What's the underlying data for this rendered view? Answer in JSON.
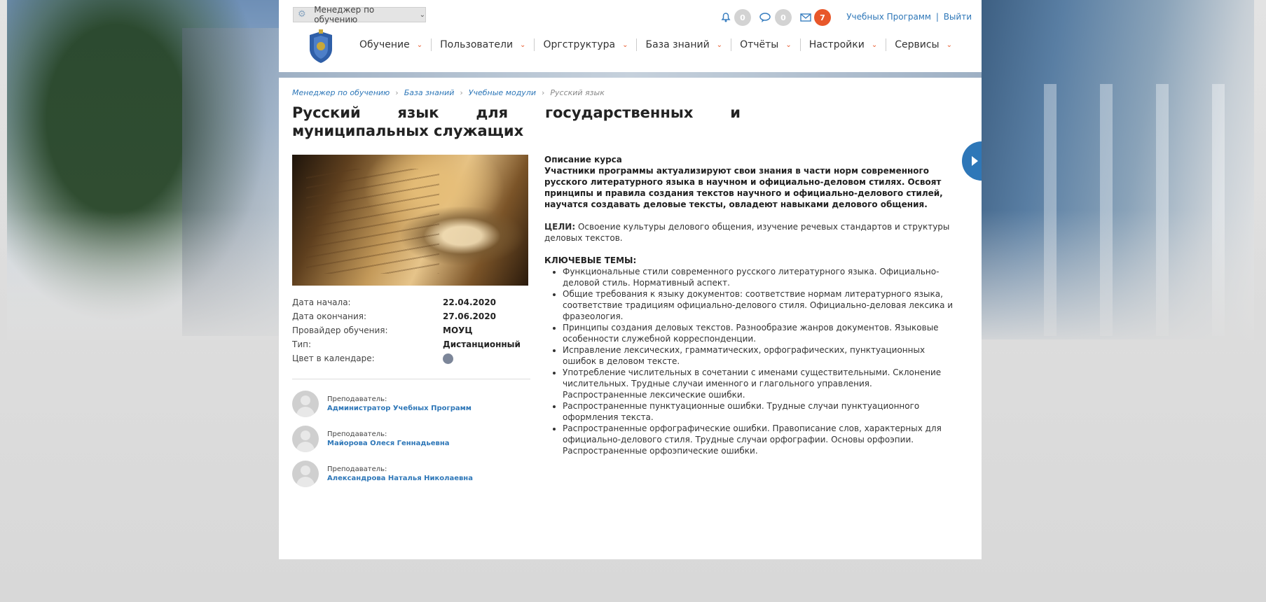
{
  "header": {
    "role": "Менеджер по обучению",
    "notifications": {
      "bell": "0",
      "chat": "0",
      "mail": "7"
    },
    "user_link": "Учебных Программ",
    "separator": "|",
    "logout": "Выйти",
    "nav": [
      "Обучение",
      "Пользователи",
      "Оргструктура",
      "База знаний",
      "Отчёты",
      "Настройки",
      "Сервисы"
    ]
  },
  "breadcrumb": [
    "Менеджер по обучению",
    "База знаний",
    "Учебные модули",
    "Русский язык"
  ],
  "title": "Русский язык для государственных и муниципальных служащих",
  "info": {
    "rows": [
      {
        "k": "Дата начала:",
        "v": "22.04.2020"
      },
      {
        "k": "Дата окончания:",
        "v": "27.06.2020"
      },
      {
        "k": "Провайдер обучения:",
        "v": "МОУЦ"
      },
      {
        "k": "Тип:",
        "v": "Дистанционный"
      }
    ],
    "color_label": "Цвет в календаре:",
    "calendar_color": "#7c8699"
  },
  "teachers": {
    "label": "Преподаватель:",
    "names": [
      "Администратор Учебных Программ",
      "Майорова Олеся Геннадьевна",
      "Александрова Наталья Николаевна"
    ]
  },
  "description": {
    "heading": "Описание курса",
    "lead": "Участники программы актуализируют свои знания в части норм современного русского литературного языка в научном и официально-деловом стилях. Освоят принципы и правила создания текстов научного и официально-делового стилей, научатся создавать деловые тексты, овладеют навыками делового общения.",
    "goals_label": "ЦЕЛИ:",
    "goals_text": "Освоение культуры делового общения, изучение речевых стандартов и структуры деловых текстов.",
    "topics_label": "КЛЮЧЕВЫЕ ТЕМЫ:",
    "topics": [
      "Функциональные стили современного русского литературного языка. Официально-деловой стиль. Нормативный аспект.",
      "Общие требования к языку документов: соответствие нормам литературного языка, соответствие традициям официально-делового стиля. Официально-деловая лексика и фразеология.",
      "Принципы создания деловых текстов. Разнообразие жанров документов. Языковые особенности служебной корреспонденции.",
      "Исправление лексических, грамматических, орфографических, пунктуационных ошибок в деловом тексте.",
      "Употребление числительных в сочетании с именами существительными. Склонение числительных. Трудные случаи именного и глагольного управления. Распространенные лексические ошибки.",
      "Распространенные пунктуационные ошибки. Трудные случаи пунктуационного оформления текста.",
      "Распространенные орфографические ошибки. Правописание слов, характерных для официально-делового стиля. Трудные случаи орфографии. Основы орфоэпии. Распространенные орфоэпические ошибки."
    ]
  },
  "icons": {
    "role": "gear-icon",
    "bell": "bell-icon",
    "chat": "chat-icon",
    "mail": "mail-icon",
    "logo": "coat-of-arms-icon",
    "side": "play-icon"
  },
  "colors": {
    "accent": "#2e77b8",
    "badge": "#e8572a",
    "nav_chevron": "#e8572a"
  }
}
